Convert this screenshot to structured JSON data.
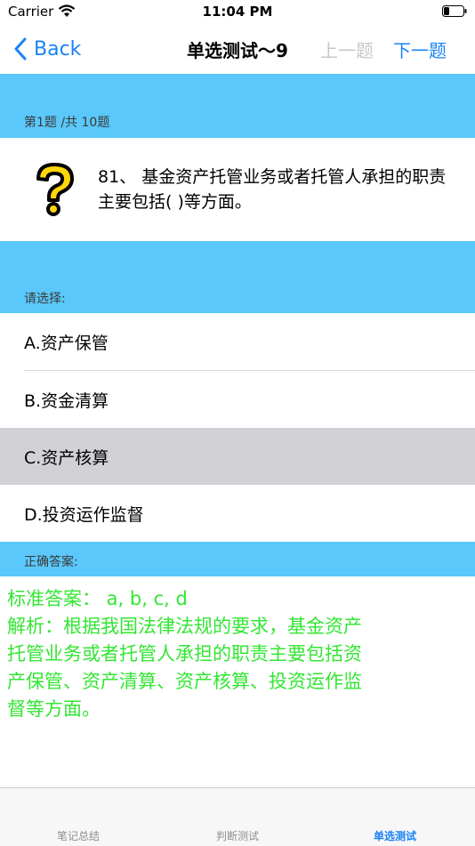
{
  "status": {
    "carrier": "Carrier",
    "time": "11:04 PM"
  },
  "nav": {
    "back_label": "Back",
    "title": "单选测试～9",
    "prev_label": "上一题",
    "next_label": "下一题"
  },
  "question": {
    "progress": "第1题 /共 10题",
    "text": "81、 基金资产托管业务或者托管人承担的职责主要包括( )等方面。"
  },
  "options": {
    "prompt": "请选择:",
    "items": [
      {
        "label": "A.资产保管"
      },
      {
        "label": "B.资金清算"
      },
      {
        "label": "C.资产核算"
      },
      {
        "label": "D.投资运作监督"
      }
    ],
    "selected": "C"
  },
  "answer": {
    "header": "正确答案:",
    "standard": "标准答案： a, b, c, d",
    "analysis_lines": [
      "解析：根据我国法律法规的要求，基金资产",
      "托管业务或者托管人承担的职责主要包括资",
      "产保管、资产清算、资产核算、投资运作监",
      "督等方面。"
    ]
  },
  "tabs": [
    {
      "label": "笔记总结"
    },
    {
      "label": "判断测试"
    },
    {
      "label": "单选测试"
    }
  ],
  "colors": {
    "accent": "#1a83f5",
    "band": "#5ac8fa",
    "answer_text": "#33e633",
    "selected_row": "#d1d1d6"
  }
}
